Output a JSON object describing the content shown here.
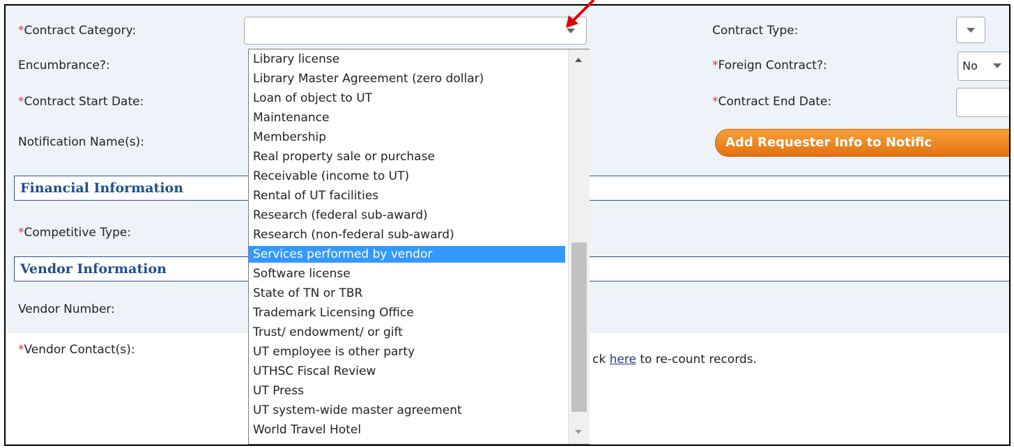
{
  "form": {
    "contract_category_label": "Contract Category:",
    "contract_category_value": "",
    "contract_type_label": "Contract Type:",
    "encumbrance_label": "Encumbrance?:",
    "foreign_contract_label": "Foreign Contract?:",
    "foreign_contract_value": "No",
    "start_date_label": "Contract Start Date:",
    "end_date_label": "Contract End Date:",
    "notification_label": "Notification Name(s):",
    "add_requester_button": "Add Requester Info to Notific",
    "competitive_type_label": "Competitive Type:",
    "vendor_number_label": "Vendor Number:",
    "vendor_contacts_label": "Vendor Contact(s):",
    "recount_prefix": "ck ",
    "recount_link": "here",
    "recount_suffix": " to re-count records.",
    "required_marker": "*"
  },
  "sections": {
    "financial": "Financial Information",
    "vendor": "Vendor Information"
  },
  "dropdown": {
    "selected": "Services performed by vendor",
    "options": [
      "Library license",
      "Library Master Agreement (zero dollar)",
      "Loan of object to UT",
      "Maintenance",
      "Membership",
      "Real property sale or purchase",
      "Receivable (income to UT)",
      "Rental of UT facilities",
      "Research (federal sub-award)",
      "Research (non-federal sub-award)",
      "Services performed by vendor",
      "Software license",
      "State of TN or TBR",
      "Trademark Licensing Office",
      "Trust/ endowment/ or gift",
      "UT employee is other party",
      "UTHSC Fiscal Review",
      "UT Press",
      "UT system-wide master agreement",
      "World Travel Hotel"
    ]
  },
  "colors": {
    "required": "#d9363e",
    "section_text": "#1f4e8c",
    "selected_option": "#3399ff",
    "button": "#f08a24",
    "annotation_arrow": "#e00000"
  },
  "icons": {
    "annotation": "red-arrow-icon",
    "dropdown": "chevron-down-icon"
  }
}
